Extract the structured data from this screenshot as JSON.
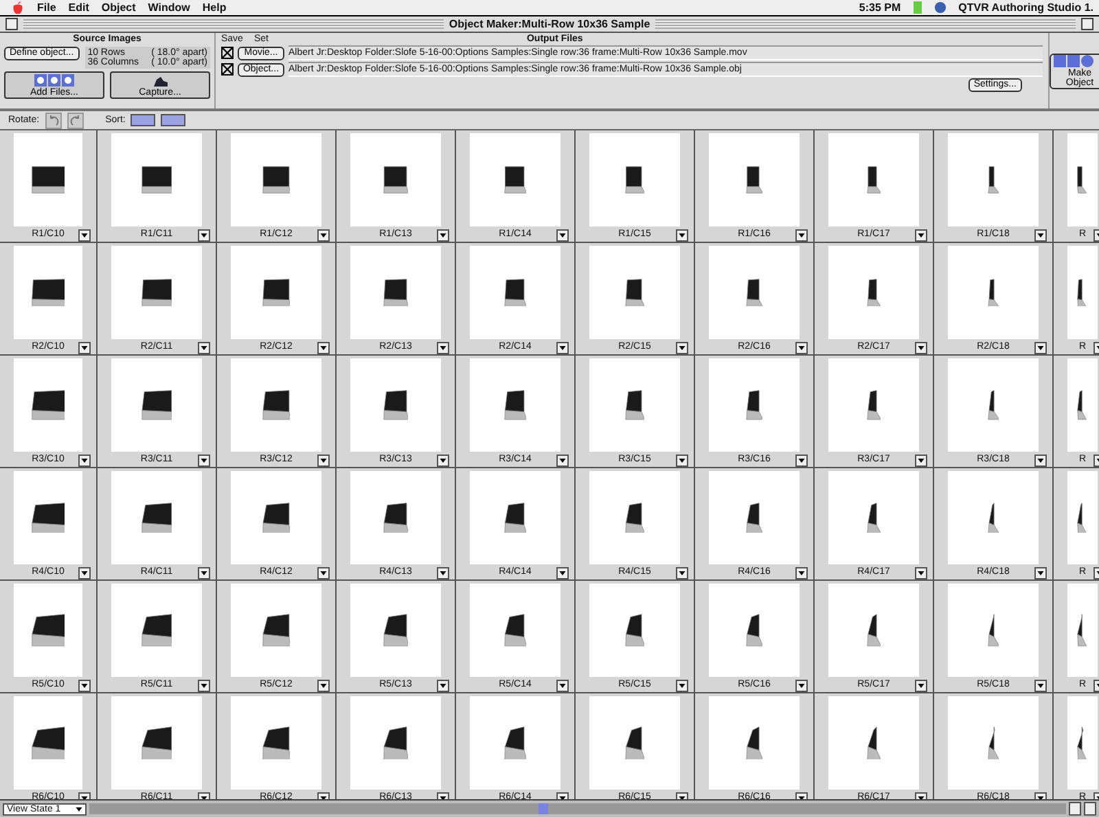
{
  "menu_bar": {
    "items": [
      "File",
      "Edit",
      "Object",
      "Window",
      "Help"
    ],
    "clock": "5:35 PM",
    "app": "QTVR Authoring Studio 1."
  },
  "window": {
    "title": "Object Maker:Multi-Row 10x36 Sample"
  },
  "source_images": {
    "heading": "Source Images",
    "define_button": "Define object...",
    "rows": "10 Rows",
    "rows_apart": "( 18.0° apart)",
    "columns": "36 Columns",
    "columns_apart": "( 10.0° apart)",
    "add_button": "Add Files...",
    "capture_button": "Capture..."
  },
  "output_files": {
    "heading": "Output Files",
    "save_label": "Save",
    "set_label": "Set",
    "files": [
      {
        "checked": true,
        "button": "Movie...",
        "path": "Albert Jr:Desktop Folder:Slofe 5-16-00:Options Samples:Single row:36 frame:Multi-Row 10x36 Sample.mov"
      },
      {
        "checked": true,
        "button": "Object...",
        "path": "Albert Jr:Desktop Folder:Slofe 5-16-00:Options Samples:Single row:36 frame:Multi-Row 10x36 Sample.obj"
      }
    ],
    "settings_button": "Settings..."
  },
  "make_button": "Make Object",
  "toolbar": {
    "rotate_label": "Rotate:",
    "sort_label": "Sort:"
  },
  "grid": {
    "rows": [
      {
        "cells": [
          "R1/C10",
          "R1/C11",
          "R1/C12",
          "R1/C13",
          "R1/C14",
          "R1/C15",
          "R1/C16",
          "R1/C17",
          "R1/C18",
          "R"
        ]
      },
      {
        "cells": [
          "R2/C10",
          "R2/C11",
          "R2/C12",
          "R2/C13",
          "R2/C14",
          "R2/C15",
          "R2/C16",
          "R2/C17",
          "R2/C18",
          "R"
        ]
      },
      {
        "cells": [
          "R3/C10",
          "R3/C11",
          "R3/C12",
          "R3/C13",
          "R3/C14",
          "R3/C15",
          "R3/C16",
          "R3/C17",
          "R3/C18",
          "R"
        ]
      },
      {
        "cells": [
          "R4/C10",
          "R4/C11",
          "R4/C12",
          "R4/C13",
          "R4/C14",
          "R4/C15",
          "R4/C16",
          "R4/C17",
          "R4/C18",
          "R"
        ]
      },
      {
        "cells": [
          "R5/C10",
          "R5/C11",
          "R5/C12",
          "R5/C13",
          "R5/C14",
          "R5/C15",
          "R5/C16",
          "R5/C17",
          "R5/C18",
          "R"
        ]
      },
      {
        "cells": [
          "R6/C10",
          "R6/C11",
          "R6/C12",
          "R6/C13",
          "R6/C14",
          "R6/C15",
          "R6/C16",
          "R6/C17",
          "R6/C18",
          "R"
        ]
      }
    ]
  },
  "status_bar": {
    "view_state": "View State 1"
  }
}
